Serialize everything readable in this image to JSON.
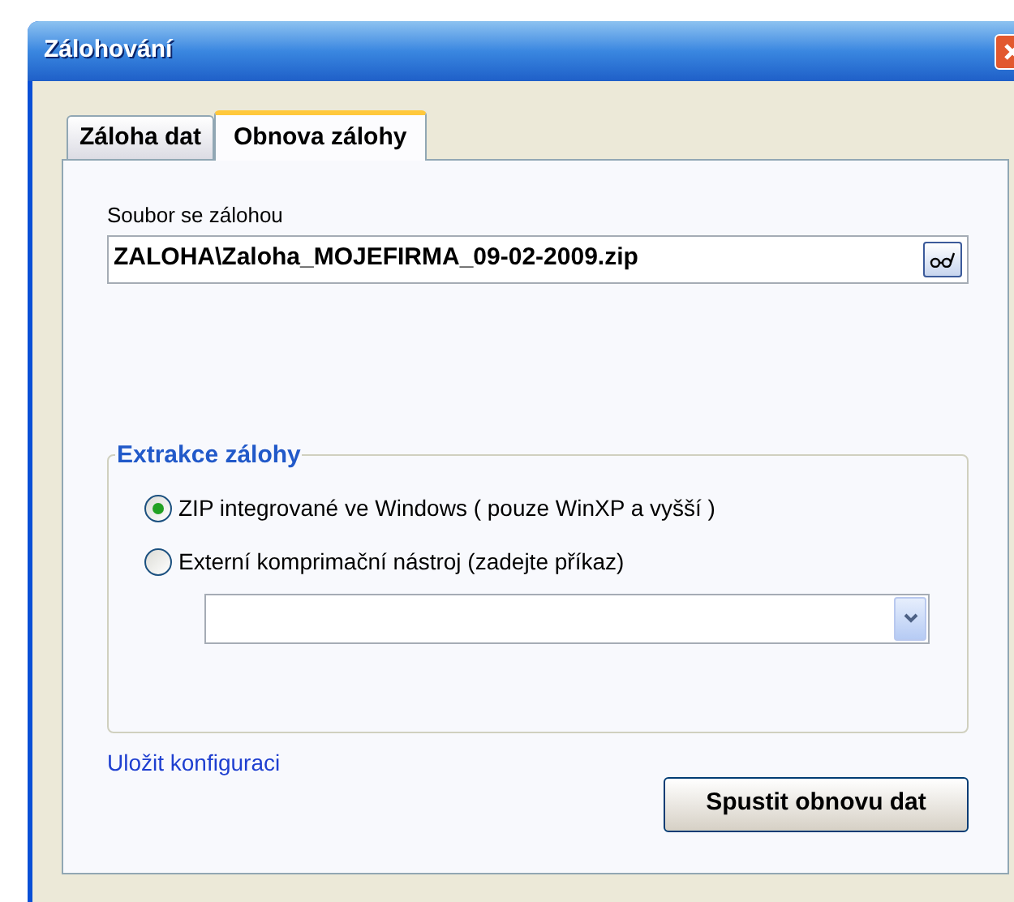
{
  "window": {
    "title": "Zálohování"
  },
  "tabs": [
    {
      "label": "Záloha dat",
      "selected": false
    },
    {
      "label": "Obnova zálohy",
      "selected": true
    }
  ],
  "file_field": {
    "label": "Soubor se zálohou",
    "value": "ZALOHA\\Zaloha_MOJEFIRMA_09-02-2009.zip"
  },
  "extraction_group": {
    "title": "Extrakce zálohy",
    "options": [
      {
        "label": "ZIP integrované ve Windows ( pouze WinXP a vyšší )",
        "selected": true
      },
      {
        "label": "Externí komprimační nástroj (zadejte příkaz)",
        "selected": false
      }
    ]
  },
  "save_config_link": "Uložit konfiguraci",
  "run_button": "Spustit obnovu dat"
}
